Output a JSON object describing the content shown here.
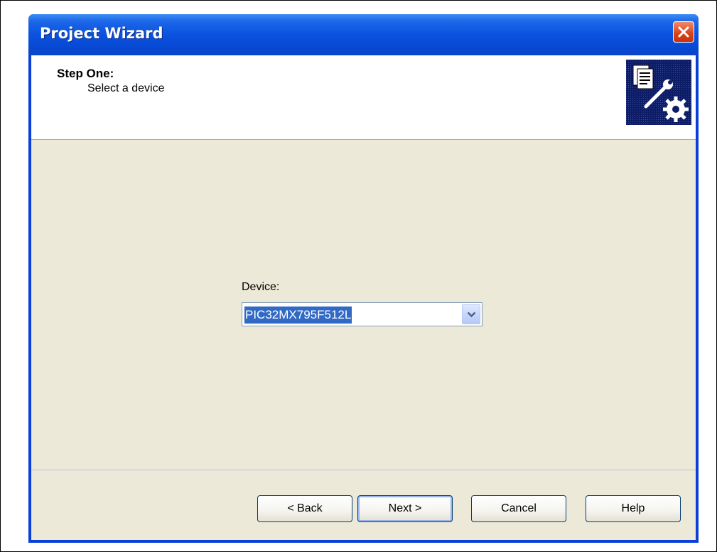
{
  "window": {
    "title": "Project Wizard"
  },
  "header": {
    "step_title": "Step One:",
    "step_subtitle": "Select a device"
  },
  "device": {
    "label": "Device:",
    "value": "PIC32MX795F512L"
  },
  "buttons": {
    "back": "< Back",
    "next": "Next >",
    "cancel": "Cancel",
    "help": "Help"
  },
  "icons": {
    "close": "close-icon",
    "wizard": "wizard-icon",
    "dropdown": "chevron-down-icon"
  }
}
